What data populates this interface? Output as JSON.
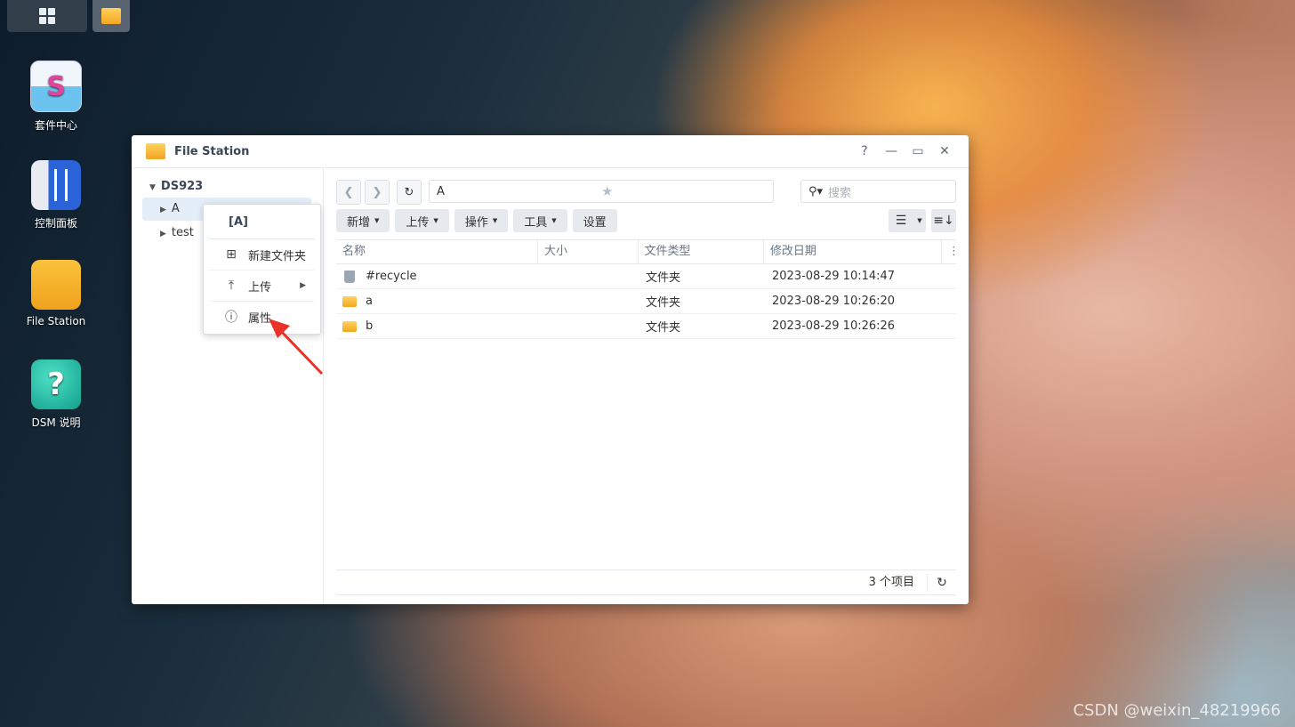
{
  "desktop": {
    "icons": [
      {
        "label": "套件中心"
      },
      {
        "label": "控制面板"
      },
      {
        "label": "File Station"
      },
      {
        "label": "DSM 说明"
      }
    ],
    "help_glyph": "?",
    "package_glyph": "S"
  },
  "window": {
    "title": "File Station",
    "help": "?",
    "minimize": "—",
    "maximize": "▭",
    "close": "✕"
  },
  "sidebar": {
    "root": "DS923",
    "items": [
      {
        "label": "A",
        "selected": true
      },
      {
        "label": "test",
        "selected": false
      }
    ]
  },
  "context_menu": {
    "header": "[A]",
    "items": [
      {
        "label": "新建文件夹",
        "icon": "new-folder-icon"
      },
      {
        "label": "上传",
        "icon": "upload-icon",
        "submenu": true
      },
      {
        "label": "属性",
        "icon": "info-icon"
      }
    ]
  },
  "nav": {
    "path": "A",
    "search_placeholder": "搜索"
  },
  "toolbar": {
    "new": "新增",
    "upload": "上传",
    "action": "操作",
    "tools": "工具",
    "settings": "设置"
  },
  "table": {
    "columns": [
      "名称",
      "大小",
      "文件类型",
      "修改日期"
    ],
    "rows": [
      {
        "name": "#recycle",
        "size": "",
        "type": "文件夹",
        "modified": "2023-08-29 10:14:47",
        "icon": "recycle-bin-icon"
      },
      {
        "name": "a",
        "size": "",
        "type": "文件夹",
        "modified": "2023-08-29 10:26:20",
        "icon": "folder-icon"
      },
      {
        "name": "b",
        "size": "",
        "type": "文件夹",
        "modified": "2023-08-29 10:26:26",
        "icon": "folder-icon"
      }
    ]
  },
  "footer": {
    "count": "3 个项目"
  },
  "watermark": "CSDN @weixin_48219966"
}
